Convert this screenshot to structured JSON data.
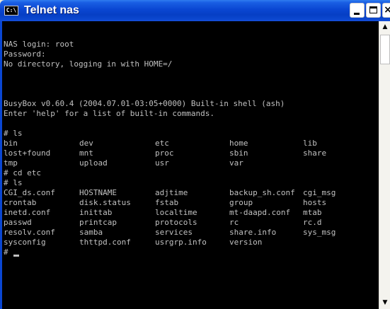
{
  "window": {
    "title": "Telnet nas",
    "icon_text": "C:\\",
    "minimize_icon": "minimize-icon",
    "maximize_icon": "maximize-icon",
    "close_glyph": "×"
  },
  "colors": {
    "titlebar": "#0a46d2",
    "console_bg": "#000000",
    "console_fg": "#c0c0c0",
    "scrollbar_bg": "#f4f3ee"
  },
  "console": {
    "lines": [
      "NAS login: root",
      "Password:",
      "No directory, logging in with HOME=/",
      "",
      "",
      "BusyBox v0.60.4 (2004.07.01-03:05+0000) Built-in shell (ash)",
      "Enter 'help' for a list of built-in commands.",
      "",
      "# ls"
    ],
    "ls_root": [
      [
        "bin",
        "dev",
        "etc",
        "home",
        "lib"
      ],
      [
        "lost+found",
        "mnt",
        "proc",
        "sbin",
        "share"
      ],
      [
        "tmp",
        "upload",
        "usr",
        "var",
        ""
      ]
    ],
    "cmd_cd": "# cd etc",
    "cmd_ls2": "# ls",
    "ls_etc": [
      [
        "CGI_ds.conf",
        "HOSTNAME",
        "adjtime",
        "backup_sh.conf",
        "cgi_msg"
      ],
      [
        "crontab",
        "disk.status",
        "fstab",
        "group",
        "hosts"
      ],
      [
        "inetd.conf",
        "inittab",
        "localtime",
        "mt-daapd.conf",
        "mtab"
      ],
      [
        "passwd",
        "printcap",
        "protocols",
        "rc",
        "rc.d"
      ],
      [
        "resolv.conf",
        "samba",
        "services",
        "share.info",
        "sys_msg"
      ],
      [
        "sysconfig",
        "thttpd.conf",
        "usrgrp.info",
        "version",
        ""
      ]
    ],
    "prompt": "# "
  },
  "scrollbar": {
    "up_arrow": "▲",
    "down_arrow": "▼"
  }
}
